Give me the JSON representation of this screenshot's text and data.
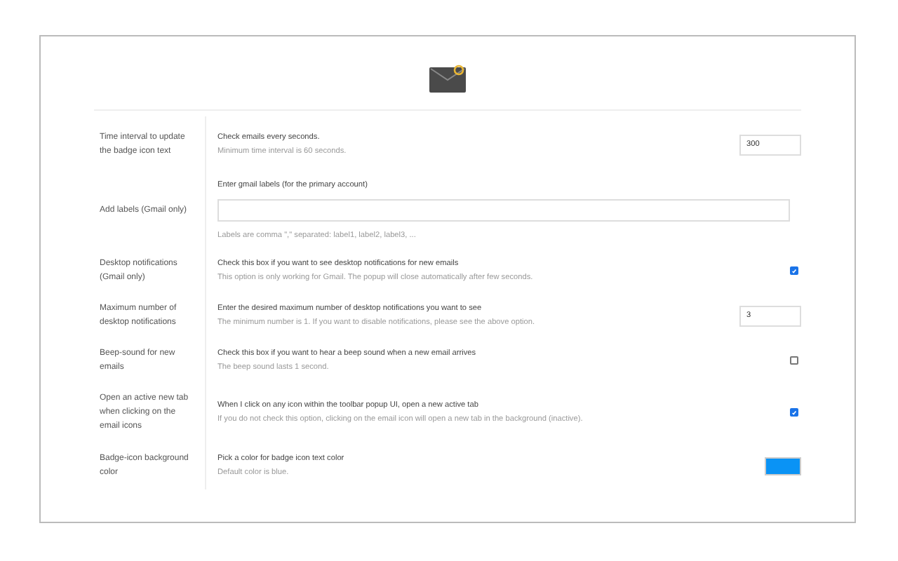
{
  "rows": [
    {
      "kind": "number",
      "label": "Time interval to update the badge icon text",
      "title": "Check emails every seconds.",
      "hint": "Minimum time interval is 60 seconds.",
      "value": "300"
    },
    {
      "kind": "text",
      "label": "Add labels (Gmail only)",
      "title": "Enter gmail labels (for the primary account)",
      "hint": "Labels are comma \",\" separated: label1, label2, label3, ..."
    },
    {
      "kind": "checkbox",
      "label": "Desktop notifications (Gmail only)",
      "title": "Check this box if you want to see desktop notifications for new emails",
      "hint": "This option is only working for Gmail. The popup will close automatically after few seconds.",
      "checked": true
    },
    {
      "kind": "number",
      "label": "Maximum number of desktop notifications",
      "title": "Enter the desired maximum number of desktop notifications you want to see",
      "hint": "The minimum number is 1. If you want to disable notifications, please see the above option.",
      "value": "3"
    },
    {
      "kind": "checkbox",
      "label": "Beep-sound for new emails",
      "title": "Check this box if you want to hear a beep sound when a new email arrives",
      "hint": "The beep sound lasts 1 second.",
      "checked": false
    },
    {
      "kind": "checkbox",
      "label": "Open an active new tab when clicking on the email icons",
      "title": "When I click on any icon within the toolbar popup UI, open a new active tab",
      "hint": "If you do not check this option, clicking on the email icon will open a new tab in the background (inactive).",
      "checked": true
    },
    {
      "kind": "color",
      "label": "Badge-icon background color",
      "title": "Pick a color for badge icon text color",
      "hint": "Default color is blue.",
      "color": "#0a93f5"
    }
  ]
}
